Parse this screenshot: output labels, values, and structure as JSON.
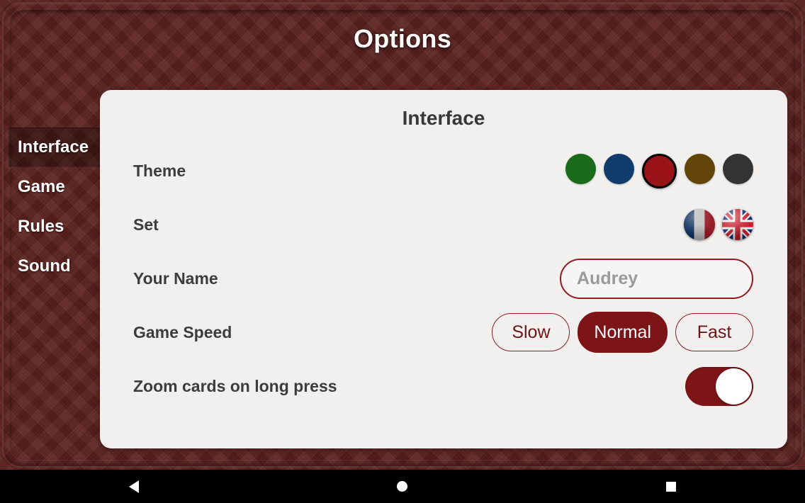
{
  "app": {
    "title": "Options"
  },
  "sidebar": {
    "items": [
      {
        "label": "Interface",
        "selected": true
      },
      {
        "label": "Game",
        "selected": false
      },
      {
        "label": "Rules",
        "selected": false
      },
      {
        "label": "Sound",
        "selected": false
      }
    ]
  },
  "panel": {
    "title": "Interface",
    "rows": {
      "theme": {
        "label": "Theme",
        "swatches": [
          {
            "name": "green",
            "color": "#1a6b1a",
            "selected": false
          },
          {
            "name": "blue",
            "color": "#103d6b",
            "selected": false
          },
          {
            "name": "red",
            "color": "#9a1318",
            "selected": true
          },
          {
            "name": "brown",
            "color": "#63450a",
            "selected": false
          },
          {
            "name": "gray",
            "color": "#333333",
            "selected": false
          }
        ]
      },
      "set": {
        "label": "Set",
        "flags": [
          {
            "name": "france-flag-icon",
            "selected": false
          },
          {
            "name": "uk-flag-icon",
            "selected": true
          }
        ]
      },
      "name": {
        "label": "Your Name",
        "value": "",
        "placeholder": "Audrey"
      },
      "speed": {
        "label": "Game Speed",
        "options": [
          {
            "label": "Slow",
            "selected": false
          },
          {
            "label": "Normal",
            "selected": true
          },
          {
            "label": "Fast",
            "selected": false
          }
        ]
      },
      "zoom": {
        "label": "Zoom cards on long press",
        "on": true
      }
    }
  },
  "navbar": {
    "buttons": [
      {
        "name": "back-icon",
        "label": "Back"
      },
      {
        "name": "home-icon",
        "label": "Home"
      },
      {
        "name": "recents-icon",
        "label": "Recents"
      }
    ]
  },
  "colors": {
    "felt": "#5a1f1c",
    "panel": "#f1f0ee",
    "accent": "#7d1418",
    "accent_border": "#8e1c22",
    "label_text": "#3c3c3c",
    "placeholder": "#9a9a9a"
  }
}
